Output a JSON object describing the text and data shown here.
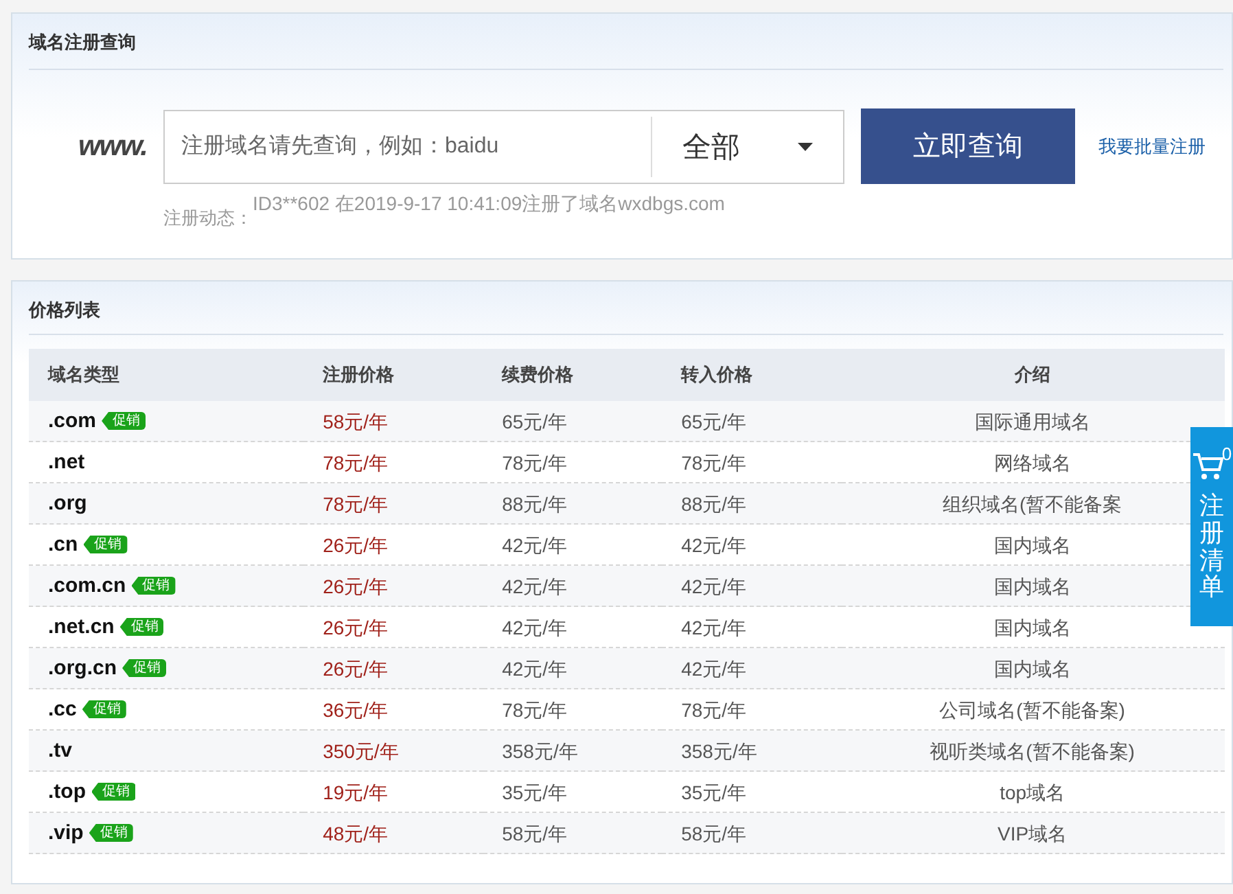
{
  "search_panel": {
    "title": "域名注册查询",
    "prefix": "www.",
    "search": {
      "placeholder": "注册域名请先查询，例如：baidu"
    },
    "scope": "全部",
    "submit": "立即查询",
    "bulk_link": "我要批量注册",
    "ticker_label": "注册动态：",
    "ticker": [
      "ID3**602 在2019-9-17 10:41:09注册了域名wxdbgs.com"
    ]
  },
  "price_panel": {
    "title": "价格列表",
    "columns": [
      "域名类型",
      "注册价格",
      "续费价格",
      "转入价格",
      "介绍"
    ],
    "rows": [
      {
        "suffix": ".com",
        "promo": "促销",
        "register": "58元/年",
        "renew": "65元/年",
        "transfer": "65元/年",
        "intro": "国际通用域名"
      },
      {
        "suffix": ".net",
        "register": "78元/年",
        "renew": "78元/年",
        "transfer": "78元/年",
        "intro": "网络域名"
      },
      {
        "suffix": ".org",
        "register": "78元/年",
        "renew": "88元/年",
        "transfer": "88元/年",
        "intro": "组织域名(暂不能备案"
      },
      {
        "suffix": ".cn",
        "promo": "促销",
        "register": "26元/年",
        "renew": "42元/年",
        "transfer": "42元/年",
        "intro": "国内域名"
      },
      {
        "suffix": ".com.cn",
        "promo": "促销",
        "register": "26元/年",
        "renew": "42元/年",
        "transfer": "42元/年",
        "intro": "国内域名"
      },
      {
        "suffix": ".net.cn",
        "promo": "促销",
        "register": "26元/年",
        "renew": "42元/年",
        "transfer": "42元/年",
        "intro": "国内域名"
      },
      {
        "suffix": ".org.cn",
        "promo": "促销",
        "register": "26元/年",
        "renew": "42元/年",
        "transfer": "42元/年",
        "intro": "国内域名"
      },
      {
        "suffix": ".cc",
        "promo": "促销",
        "register": "36元/年",
        "renew": "78元/年",
        "transfer": "78元/年",
        "intro": "公司域名(暂不能备案)"
      },
      {
        "suffix": ".tv",
        "register": "350元/年",
        "renew": "358元/年",
        "transfer": "358元/年",
        "intro": "视听类域名(暂不能备案)"
      },
      {
        "suffix": ".top",
        "promo": "促销",
        "register": "19元/年",
        "renew": "35元/年",
        "transfer": "35元/年",
        "intro": "top域名"
      },
      {
        "suffix": ".vip",
        "promo": "促销",
        "register": "48元/年",
        "renew": "58元/年",
        "transfer": "58元/年",
        "intro": "VIP域名"
      }
    ]
  },
  "cart": {
    "count": "0",
    "label": "注册清单"
  }
}
